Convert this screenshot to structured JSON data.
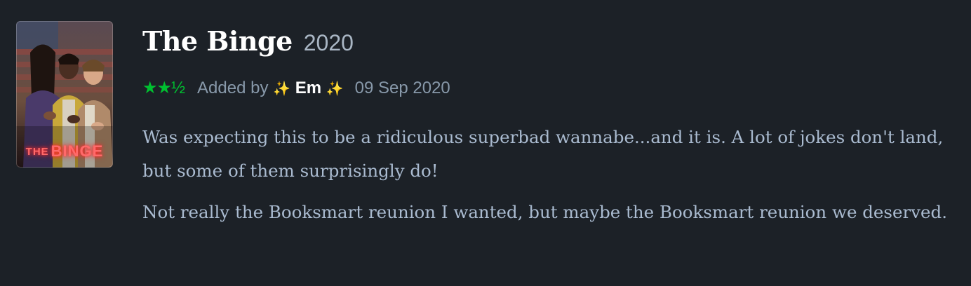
{
  "film": {
    "title": "The Binge",
    "year": "2020",
    "poster_title_small": "THE",
    "poster_title_big": "BINGE"
  },
  "rating": {
    "stars_text": "★★½",
    "value": 2.5,
    "max": 5,
    "color": "#00c030"
  },
  "meta": {
    "added_by_label": "Added by",
    "sparkle_left": "✨",
    "username": "Em",
    "sparkle_right": "✨",
    "date": "09 Sep 2020"
  },
  "review": {
    "paragraphs": [
      "Was expecting this to be a ridiculous superbad wannabe...and it is. A lot of jokes don't land, but some of them surprisingly do!",
      "Not really the Booksmart reunion I wanted, but maybe the Booksmart reunion we deserved."
    ]
  },
  "colors": {
    "background": "#1c2127",
    "title": "#ffffff",
    "muted": "#8899aa",
    "body_text": "#aabbd0"
  }
}
